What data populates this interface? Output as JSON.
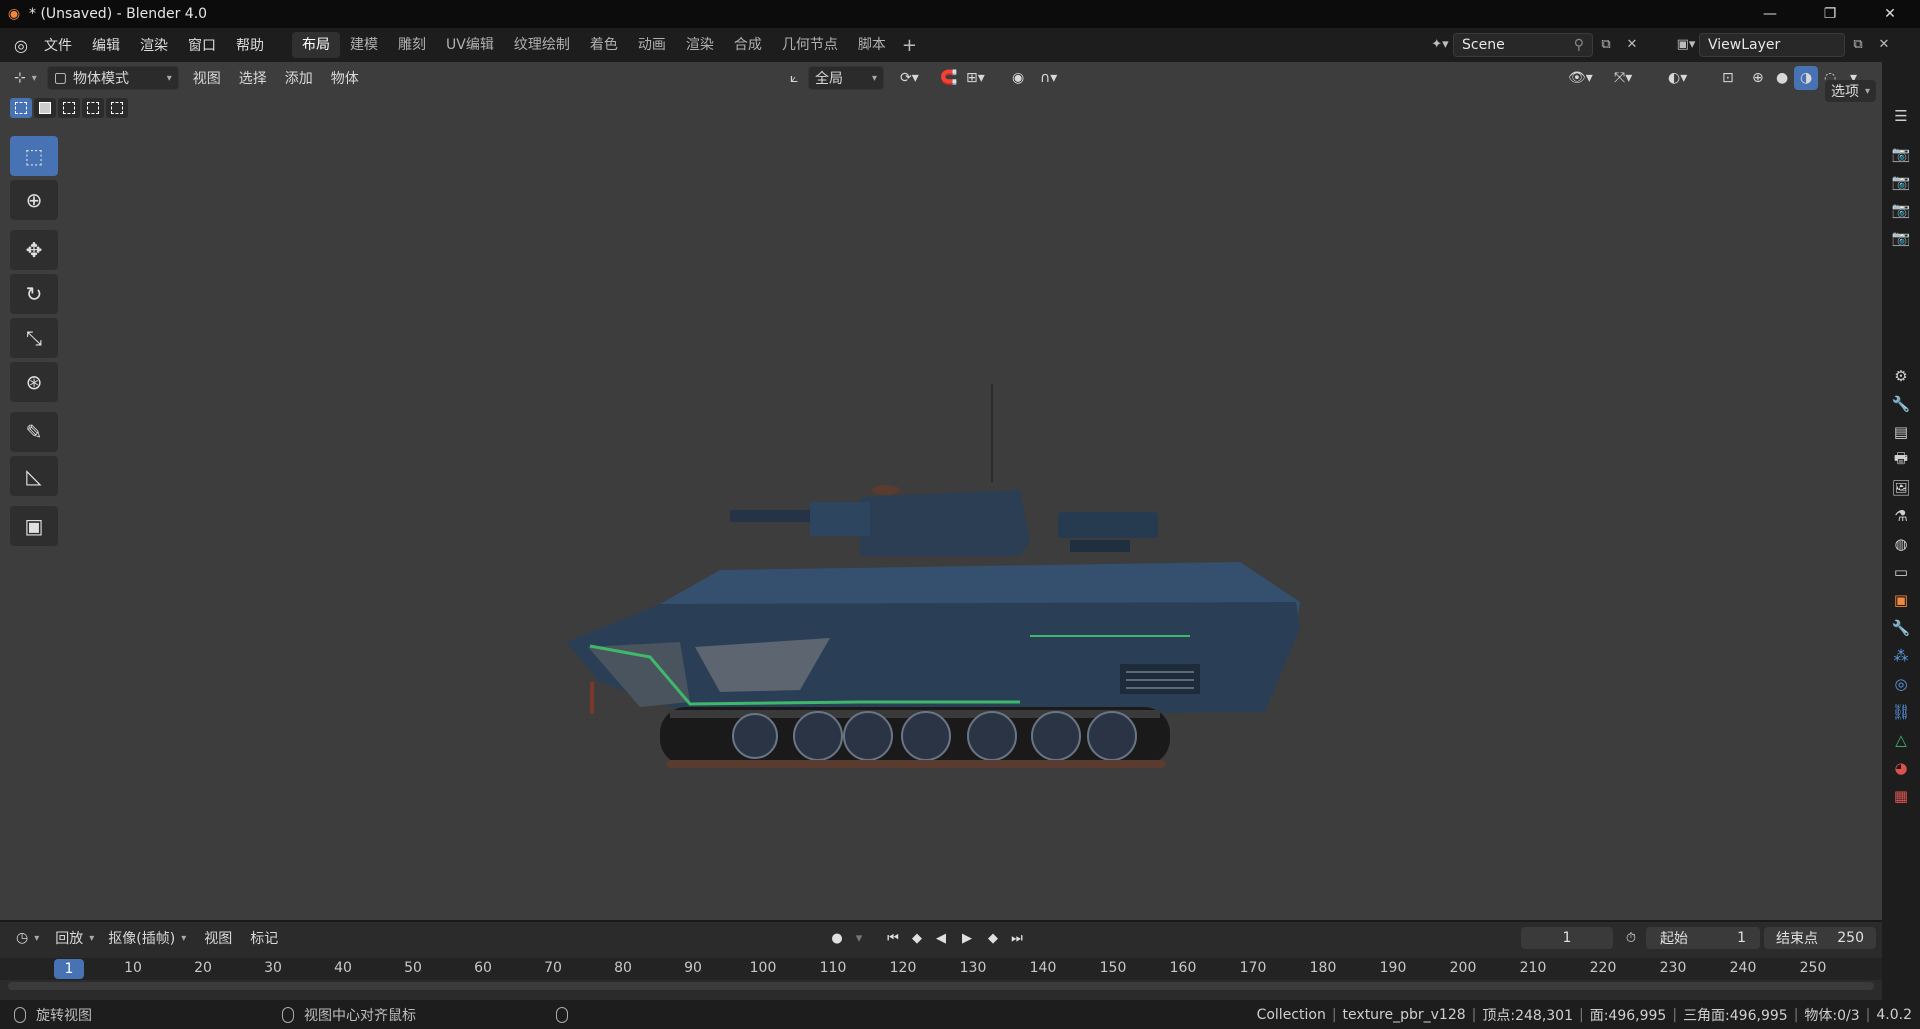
{
  "window": {
    "title": "* (Unsaved) - Blender 4.0",
    "minimize": "—",
    "maximize": "❐",
    "close": "✕"
  },
  "menubar": {
    "items": [
      "文件",
      "编辑",
      "渲染",
      "窗口",
      "帮助"
    ],
    "workspaces": [
      "布局",
      "建模",
      "雕刻",
      "UV编辑",
      "纹理绘制",
      "着色",
      "动画",
      "渲染",
      "合成",
      "几何节点",
      "脚本"
    ],
    "active_workspace": "布局",
    "add_workspace": "+",
    "scene_name": "Scene",
    "view_layer_name": "ViewLayer"
  },
  "viewport_header": {
    "mode": "物体模式",
    "menus": [
      "视图",
      "选择",
      "添加",
      "物体"
    ],
    "transform_orientation": "全局",
    "options_label": "选项"
  },
  "toolbar": {
    "tools": [
      {
        "name": "select-box-tool",
        "glyph": "⬚",
        "active": true
      },
      {
        "name": "cursor-tool",
        "glyph": "⊕",
        "active": false
      },
      {
        "name": "move-tool",
        "glyph": "✥",
        "active": false
      },
      {
        "name": "rotate-tool",
        "glyph": "↻",
        "active": false
      },
      {
        "name": "scale-tool",
        "glyph": "⤡",
        "active": false
      },
      {
        "name": "transform-tool",
        "glyph": "⊛",
        "active": false
      },
      {
        "name": "annotate-tool",
        "glyph": "✎",
        "active": false
      },
      {
        "name": "measure-tool",
        "glyph": "📐",
        "active": false
      },
      {
        "name": "add-cube-tool",
        "glyph": "▣",
        "active": false
      }
    ]
  },
  "timeline": {
    "playback_label": "回放",
    "keying_label": "抠像(插帧)",
    "view_label": "视图",
    "marker_label": "标记",
    "current_frame": "1",
    "start_label": "起始",
    "start_value": "1",
    "end_label": "结束点",
    "end_value": "250",
    "ruler_ticks": [
      "1",
      "10",
      "20",
      "30",
      "40",
      "50",
      "60",
      "70",
      "80",
      "90",
      "100",
      "110",
      "120",
      "130",
      "140",
      "150",
      "160",
      "170",
      "180",
      "190",
      "200",
      "210",
      "220",
      "230",
      "240",
      "250"
    ]
  },
  "statusbar": {
    "hint_left": "旋转视图",
    "hint_middle": "视图中心对齐鼠标",
    "collection": "Collection",
    "object": "texture_pbr_v128",
    "verts": "顶点:248,301",
    "faces": "面:496,995",
    "tris": "三角面:496,995",
    "objects": "物体:0/3",
    "version": "4.0.2"
  },
  "colors": {
    "accent": "#4772b3",
    "viewport_bg": "#3d3d3d",
    "tank_body": "#2a3f56",
    "tank_highlight": "#3fb86a"
  }
}
